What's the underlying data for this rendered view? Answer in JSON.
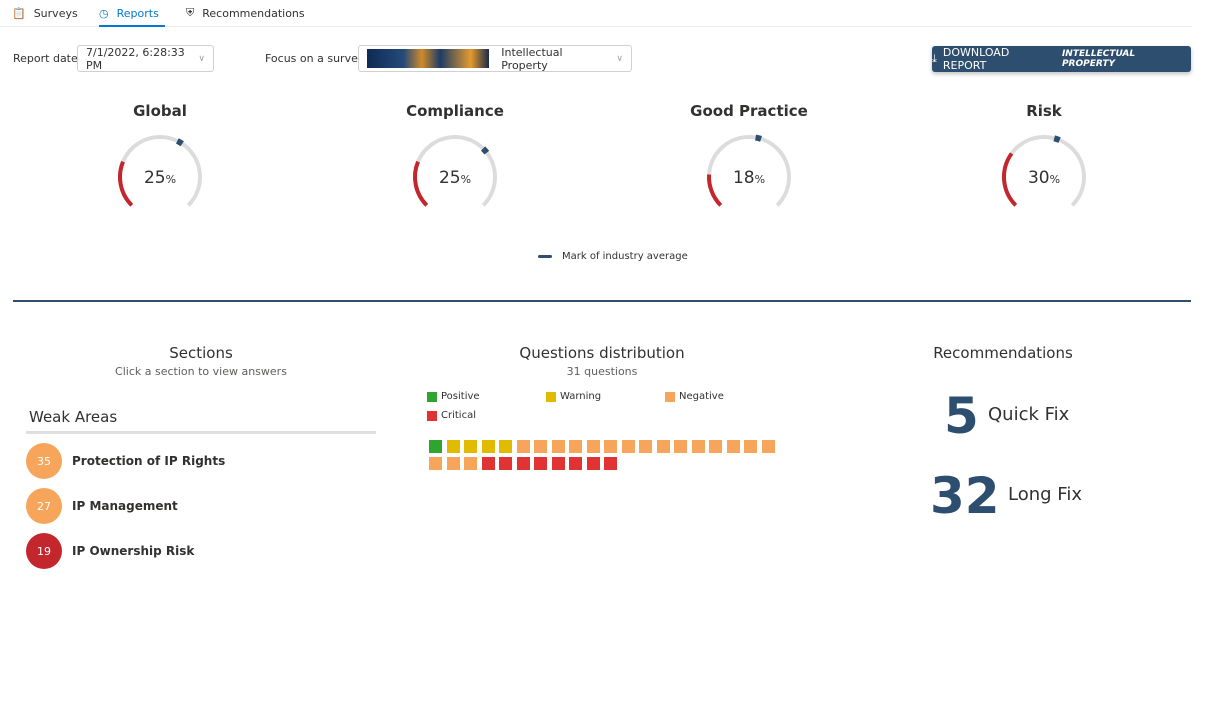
{
  "tabs": [
    {
      "label": "Surveys",
      "icon": "clipboard-icon"
    },
    {
      "label": "Reports",
      "icon": "pie-chart-icon",
      "active": true
    },
    {
      "label": "Recommendations",
      "icon": "shield-check-icon"
    }
  ],
  "filters": {
    "report_date_label": "Report date",
    "report_date_value": "7/1/2022, 6:28:33 PM",
    "focus_label": "Focus on a survey",
    "survey_value": "Intellectual Property"
  },
  "download": {
    "label": "DOWNLOAD REPORT",
    "survey": "INTELLECTUAL PROPERTY",
    "icon": "download-icon"
  },
  "colors": {
    "accent": "#2d4e6e",
    "gauge_fill": "#c4262e",
    "gauge_track": "#dcdcdc",
    "positive": "#2ea52e",
    "warning": "#e0bb00",
    "negative": "#f7a55a",
    "critical": "#e03434"
  },
  "gauges": [
    {
      "title": "Global",
      "value": 25,
      "unit": "%",
      "industry_avg": 61
    },
    {
      "title": "Compliance",
      "value": 25,
      "unit": "%",
      "industry_avg": 68
    },
    {
      "title": "Good Practice",
      "value": 18,
      "unit": "%",
      "industry_avg": 55
    },
    {
      "title": "Risk",
      "value": 30,
      "unit": "%",
      "industry_avg": 57
    }
  ],
  "gauge_legend": "Mark of industry average",
  "sections": {
    "title": "Sections",
    "subtitle": "Click a section to view answers",
    "weak_title": "Weak Areas",
    "items": [
      {
        "score": "35",
        "name": "Protection of IP Rights",
        "color": "#f7a55a"
      },
      {
        "score": "27",
        "name": "IP Management",
        "color": "#f7a55a"
      },
      {
        "score": "19",
        "name": "IP Ownership Risk",
        "color": "#c4262e"
      }
    ]
  },
  "distribution": {
    "title": "Questions distribution",
    "subtitle": "31 questions",
    "legend": {
      "positive": "Positive",
      "warning": "Warning",
      "negative": "Negative",
      "critical": "Critical"
    },
    "counts": {
      "positive": 1,
      "warning": 4,
      "negative": 18,
      "critical": 8
    }
  },
  "recommendations": {
    "title": "Recommendations",
    "quick_count": "5",
    "quick_label": "Quick Fix",
    "long_count": "32",
    "long_label": "Long Fix"
  }
}
